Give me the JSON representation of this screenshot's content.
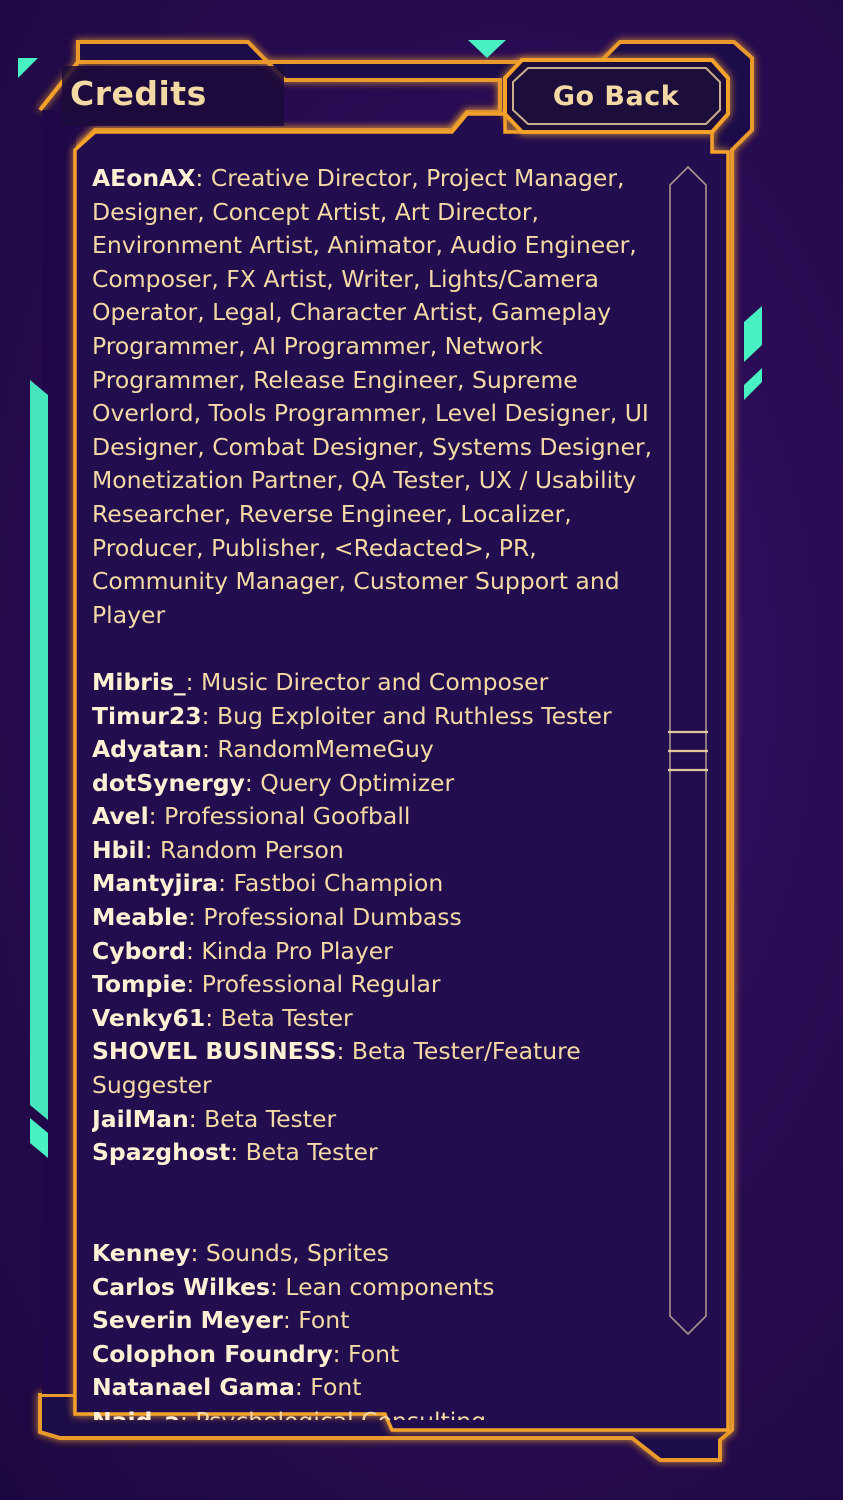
{
  "header": {
    "title": "Credits",
    "back_label": "Go Back"
  },
  "colors": {
    "frame_orange": "#f5a22a",
    "accent_teal": "#49f0c2",
    "text_cream": "#f4d9a4",
    "panel_purple": "#22084f"
  },
  "credits": {
    "primary": {
      "name": "AEonAX",
      "role": "Creative Director,  Project Manager,  Designer,  Concept Artist,  Art Director,  Environment Artist,  Animator,  Audio Engineer,  Composer,  FX Artist,  Writer,  Lights/Camera Operator,  Legal,  Character Artist,  Gameplay Programmer,  AI Programmer,  Network Programmer,  Release Engineer,  Supreme Overlord,  Tools Programmer,  Level Designer,  UI Designer,  Combat Designer,  Systems Designer,  Monetization Partner,  QA Tester,  UX / Usability Researcher, Reverse Engineer,  Localizer,  Producer,  Publisher,  <Redacted>,  PR,  Community Manager,  Customer Support and Player"
    },
    "contributors": [
      {
        "name": "Mibris_",
        "role": "Music Director and Composer"
      },
      {
        "name": "Timur23",
        "role": "Bug Exploiter and Ruthless Tester"
      },
      {
        "name": "Adyatan",
        "role": "RandomMemeGuy"
      },
      {
        "name": "dotSynergy",
        "role": "Query Optimizer"
      },
      {
        "name": "Avel",
        "role": "Professional Goofball"
      },
      {
        "name": "Hbil",
        "role": "Random Person"
      },
      {
        "name": "Mantyjira",
        "role": "Fastboi Champion"
      },
      {
        "name": "Meable",
        "role": "Professional Dumbass"
      },
      {
        "name": "Cybord",
        "role": "Kinda Pro Player"
      },
      {
        "name": "Tompie",
        "role": "Professional Regular"
      },
      {
        "name": "Venky61",
        "role": "Beta Tester"
      },
      {
        "name": "SHOVEL BUSINESS",
        "role": "Beta Tester/Feature Suggester"
      },
      {
        "name": "JailMan",
        "role": "Beta Tester"
      },
      {
        "name": "Spazghost",
        "role": "Beta Tester"
      }
    ],
    "assets": [
      {
        "name": "Kenney",
        "role": "Sounds, Sprites"
      },
      {
        "name": "Carlos Wilkes",
        "role": "Lean components"
      },
      {
        "name": "Severin Meyer",
        "role": "Font"
      },
      {
        "name": "Colophon Foundry",
        "role": "Font"
      },
      {
        "name": "Natanael Gama",
        "role": "Font"
      },
      {
        "name": "Naid_a",
        "role": "Psychological Consulting"
      }
    ]
  }
}
